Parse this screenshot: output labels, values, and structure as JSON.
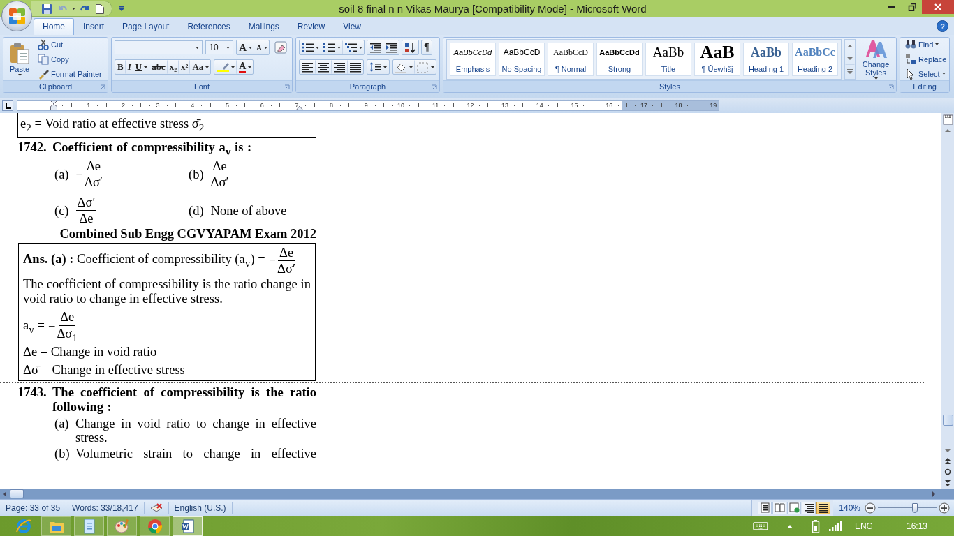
{
  "window": {
    "title": "soil 8   final n n Vikas Maurya [Compatibility Mode] - Microsoft Word",
    "help": "?"
  },
  "tabs": [
    {
      "label": "Home",
      "selected": true
    },
    {
      "label": "Insert",
      "selected": false
    },
    {
      "label": "Page Layout",
      "selected": false
    },
    {
      "label": "References",
      "selected": false
    },
    {
      "label": "Mailings",
      "selected": false
    },
    {
      "label": "Review",
      "selected": false
    },
    {
      "label": "View",
      "selected": false
    }
  ],
  "clipboard": {
    "label": "Clipboard",
    "paste": "Paste",
    "items": [
      "Cut",
      "Copy",
      "Format Painter"
    ]
  },
  "font": {
    "label": "Font",
    "size": "10",
    "grow": "A",
    "shrink": "A",
    "color_button": "A",
    "buttons": [
      {
        "text": "B",
        "kind": "bold"
      },
      {
        "text": "I",
        "kind": "italic"
      },
      {
        "text": "U",
        "kind": "underline"
      },
      {
        "text": "abc",
        "kind": "strike"
      },
      {
        "text": "x₂",
        "kind": "subscript"
      },
      {
        "text": "x²",
        "kind": "superscript"
      },
      {
        "text": "Aa",
        "kind": "case"
      }
    ]
  },
  "paragraph": {
    "label": "Paragraph",
    "show_marks": "¶"
  },
  "styles": {
    "label": "Styles",
    "change_styles": "Change Styles",
    "items": [
      {
        "preview": "AaBbCcDd",
        "label": "Emphasis",
        "kind": "emphasis"
      },
      {
        "preview": "AaBbCcD",
        "label": "No Spacing",
        "kind": "plain"
      },
      {
        "preview": "AaBbCcD",
        "label": "¶ Normal",
        "kind": "serif"
      },
      {
        "preview": "AaBbCcDd",
        "label": "Strong",
        "kind": "strong"
      },
      {
        "preview": "AaBb",
        "label": "Title",
        "kind": "title"
      },
      {
        "preview": "AaB",
        "label": "¶ Ûewhšj",
        "kind": "big"
      },
      {
        "preview": "AaBb",
        "label": "Heading 1",
        "kind": "heading1"
      },
      {
        "preview": "AaBbCc",
        "label": "Heading 2",
        "kind": "heading2"
      }
    ]
  },
  "editing": {
    "label": "Editing",
    "items": [
      {
        "label": "Find",
        "kind": "find"
      },
      {
        "label": "Replace",
        "kind": "replace"
      },
      {
        "label": "Select",
        "kind": "select"
      }
    ]
  },
  "ruler": {
    "marks": [
      "1",
      "2",
      "3",
      "4",
      "5",
      "6",
      "7",
      "8",
      "9",
      "10",
      "11",
      "12",
      "13",
      "14",
      "15",
      "16",
      "17",
      "18",
      "19"
    ]
  },
  "document": {
    "blocks": [
      {
        "kind": "box_tail",
        "text": "e$_{2}$ =  Void ratio at effective stress  σ̄$_{2}$"
      },
      {
        "kind": "question",
        "number": "1742.",
        "text": "Coefficient of compressibility a$_{v}$ is :"
      },
      {
        "kind": "option_grid",
        "options": [
          {
            "label": "(a)",
            "sign": "−",
            "numerator": "Δe",
            "denominator": "Δσ′"
          },
          {
            "label": "(b)",
            "numerator": "Δe",
            "denominator": "Δσ′"
          },
          {
            "label": "(c)",
            "numerator": "Δσ′",
            "denominator": "Δe"
          },
          {
            "label": "(d)",
            "text": "None of above"
          }
        ]
      },
      {
        "kind": "source",
        "text": "Combined Sub Engg CGVYAPAM Exam 2012"
      },
      {
        "kind": "answer_box",
        "lines": [
          {
            "kind": "formula",
            "text": "**Ans. (a) :** Coefficient of compressibility (a$_{v}$) =",
            "sign": "−",
            "numerator": "Δe",
            "denominator": "Δσ′"
          },
          {
            "kind": "paragraph",
            "text": "The coefficient of compressibility is the ratio change in void ratio to change in effective stress."
          },
          {
            "kind": "formula",
            "text": "a$_{v}$ =",
            "sign": "−",
            "numerator": "Δe",
            "denominator": "Δσ$_{1}$"
          },
          {
            "kind": "paragraph",
            "text": "Δe = Change in void ratio"
          },
          {
            "kind": "paragraph",
            "text": "Δσ̄ = Change in effective stress"
          }
        ]
      },
      {
        "kind": "section_break"
      },
      {
        "kind": "question",
        "number": "1743.",
        "text": "The coefficient of compressibility is the ratio following :"
      },
      {
        "kind": "option_list",
        "options": [
          {
            "label": "(a)",
            "text": "Change in void ratio to change in effective stress."
          },
          {
            "label": "(b)",
            "text": "Volumetric strain to change in effective"
          }
        ]
      }
    ]
  },
  "status_bar": {
    "page": "Page: 33 of 35",
    "words": "Words: 33/18,417",
    "language": "English (U.S.)",
    "zoom": "140%",
    "level": 0.63,
    "views": [
      {
        "selected": false
      },
      {
        "selected": false
      },
      {
        "selected": false
      },
      {
        "selected": false
      },
      {
        "selected": true
      }
    ]
  },
  "taskbar": {
    "apps": [
      {
        "running": false,
        "selected": false
      },
      {
        "running": true,
        "selected": false
      },
      {
        "running": true,
        "selected": false
      },
      {
        "running": true,
        "selected": false
      },
      {
        "running": true,
        "selected": false
      },
      {
        "running": true,
        "selected": true
      }
    ],
    "language": "ENG",
    "clock": "16:13"
  }
}
